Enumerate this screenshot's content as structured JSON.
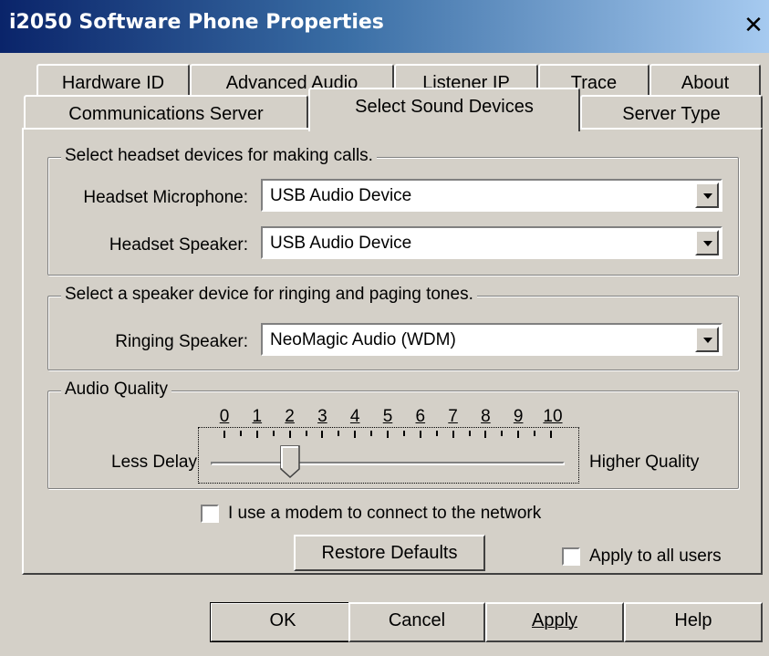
{
  "window": {
    "title": "i2050 Software Phone Properties",
    "close_symbol": "✕"
  },
  "tabs": {
    "row1": [
      "Hardware ID",
      "Advanced Audio",
      "Listener IP",
      "Trace",
      "About"
    ],
    "row2": [
      "Communications Server",
      "Select Sound Devices",
      "Server Type"
    ],
    "active": "Select Sound Devices"
  },
  "headset_group": {
    "legend": "Select headset devices for making calls.",
    "microphone_label": "Headset Microphone:",
    "microphone_value": "USB Audio Device",
    "speaker_label": "Headset Speaker:",
    "speaker_value": "USB Audio Device"
  },
  "ringing_group": {
    "legend": "Select a speaker device for ringing and paging tones.",
    "ringing_label": "Ringing Speaker:",
    "ringing_value": "NeoMagic Audio (WDM)"
  },
  "audio_quality": {
    "legend": "Audio Quality",
    "left_label": "Less Delay",
    "right_label": "Higher Quality",
    "scale_labels": [
      "0",
      "1",
      "2",
      "3",
      "4",
      "5",
      "6",
      "7",
      "8",
      "9",
      "10"
    ],
    "value": 2,
    "min": 0,
    "max": 10
  },
  "modem_checkbox": {
    "label": "I use a modem to connect to the network",
    "checked": false
  },
  "restore_button": "Restore Defaults",
  "apply_all_checkbox": {
    "label": "Apply to all users",
    "checked": false
  },
  "buttons": {
    "ok": "OK",
    "cancel": "Cancel",
    "apply": "Apply",
    "help": "Help"
  },
  "colors": {
    "title_gradient_start": "#0a246a",
    "title_gradient_end": "#a6caf0",
    "dialog_face": "#d4d0c8"
  }
}
